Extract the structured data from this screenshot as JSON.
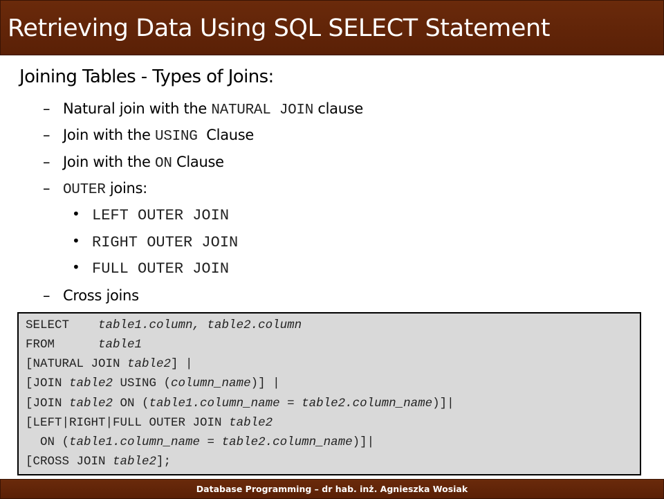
{
  "slide": {
    "title": "Retrieving Data Using SQL SELECT Statement",
    "heading": "Joining Tables - Types of Joins:"
  },
  "items": [
    {
      "text": "Natural join with the ",
      "code": "NATURAL JOIN",
      "after": " clause"
    },
    {
      "text": "Join with the ",
      "code": "USING",
      "after": "  Clause"
    },
    {
      "text": "Join with the ",
      "code": "ON",
      "after": " Clause"
    },
    {
      "text": "",
      "code": "OUTER",
      "after": " joins:"
    },
    {
      "text": "Cross joins"
    }
  ],
  "outer_join_types": [
    "LEFT OUTER JOIN",
    "RIGHT OUTER JOIN",
    "FULL OUTER JOIN"
  ],
  "code_lines": [
    [
      {
        "t": "SELECT    "
      },
      {
        "t": "table1.column, table2.column",
        "i": true
      }
    ],
    [
      {
        "t": "FROM      "
      },
      {
        "t": "table1",
        "i": true
      }
    ],
    [
      {
        "t": "[NATURAL JOIN "
      },
      {
        "t": "table2",
        "i": true
      },
      {
        "t": "] |"
      }
    ],
    [
      {
        "t": "[JOIN "
      },
      {
        "t": "table2",
        "i": true
      },
      {
        "t": " USING ("
      },
      {
        "t": "column_name",
        "i": true
      },
      {
        "t": ")] |"
      }
    ],
    [
      {
        "t": "[JOIN "
      },
      {
        "t": "table2",
        "i": true
      },
      {
        "t": " ON ("
      },
      {
        "t": "table1.column_name",
        "i": true
      },
      {
        "t": " = "
      },
      {
        "t": "table2.column_name",
        "i": true
      },
      {
        "t": ")]|"
      }
    ],
    [
      {
        "t": "[LEFT|RIGHT|FULL OUTER JOIN "
      },
      {
        "t": "table2",
        "i": true
      }
    ],
    [
      {
        "t": "  ON ("
      },
      {
        "t": "table1.column_name",
        "i": true
      },
      {
        "t": " = "
      },
      {
        "t": "table2.column_name",
        "i": true
      },
      {
        "t": ")]|"
      }
    ],
    [
      {
        "t": "[CROSS JOIN "
      },
      {
        "t": "table2",
        "i": true
      },
      {
        "t": "];"
      }
    ]
  ],
  "footer": {
    "text": "Database Programming – dr hab. inż. Agnieszka Wosiak"
  }
}
